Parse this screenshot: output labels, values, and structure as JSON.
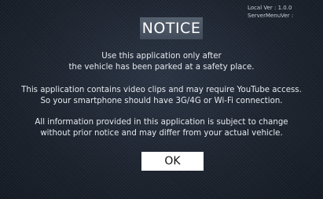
{
  "version": {
    "local": "Local Ver : 1.0.0",
    "server": "ServerMenuVer :"
  },
  "dialog": {
    "title": "NOTICE",
    "paragraphs": [
      {
        "line1": "Use this application only after",
        "line2": "the vehicle has been parked at a safety place."
      },
      {
        "line1": "This application contains video clips and may require YouTube access.",
        "line2": "So your smartphone should have 3G/4G or Wi-Fi connection."
      },
      {
        "line1": "All information provided in this application is subject to change",
        "line2": "without prior notice and may differ from your actual vehicle."
      }
    ],
    "ok_label": "OK"
  }
}
